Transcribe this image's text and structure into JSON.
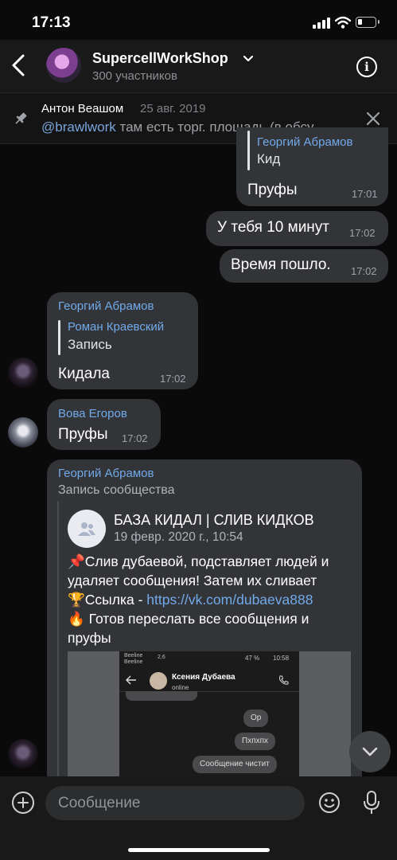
{
  "status_bar": {
    "time": "17:13"
  },
  "header": {
    "title": "SupercellWorkShop",
    "members": "300 участников",
    "info_glyph": "i"
  },
  "pinned": {
    "author": "Антон Веашом",
    "date": "25 авг. 2019",
    "mention": "@brawlwork",
    "text": " там есть торг. площадь (в обсу..."
  },
  "messages": {
    "m1": {
      "quote_name": "Георгий Абрамов",
      "quote_text": "Кид",
      "text": "Пруфы",
      "time": "17:01"
    },
    "m2": {
      "text": "У тебя 10 минут",
      "time": "17:02"
    },
    "m3": {
      "text": "Время пошло.",
      "time": "17:02"
    },
    "m4": {
      "author": "Георгий Абрамов",
      "quote_name": "Роман Краевский",
      "quote_text": "Запись",
      "text": "Кидала",
      "time": "17:02"
    },
    "m5": {
      "author": "Вова Егоров",
      "text": "Пруфы",
      "time": "17:02"
    },
    "m6": {
      "author": "Георгий Абрамов",
      "subtitle": "Запись сообщества",
      "post": {
        "community": "БАЗА КИДАЛ | СЛИВ КИДКОВ",
        "date": "19 февр. 2020 г., 10:54",
        "line1": "📌Слив дубаевой, подставляет людей и",
        "line2": "удаляет сообщения! Затем их сливает",
        "line3_prefix": "🏆Ссылка - ",
        "line3_link": "https://vk.com/dubaeva888",
        "line4": "🔥 Готов переслать все сообщения и",
        "line5": "пруфы"
      },
      "screenshot": {
        "carrier1": "Beeline",
        "carrier2": "Beeline",
        "net": "2,6",
        "battery": "47 %",
        "time": "10:58",
        "contact": "Ксения Дубаева",
        "contact_status": "online",
        "chips": [
          "Ор",
          "Пхпхпх",
          "Сообщение чистит"
        ]
      }
    }
  },
  "input": {
    "placeholder": "Сообщение"
  },
  "icons": {
    "back": "chevron-left-icon",
    "pin": "pin-icon",
    "close": "close-icon",
    "plus": "plus-icon",
    "emoji": "emoji-icon",
    "mic": "microphone-icon",
    "scroll": "chevron-down-icon",
    "community": "users-icon"
  },
  "colors": {
    "accent": "#71aaeb",
    "bubble": "#333437",
    "background": "#0a0a0a"
  }
}
